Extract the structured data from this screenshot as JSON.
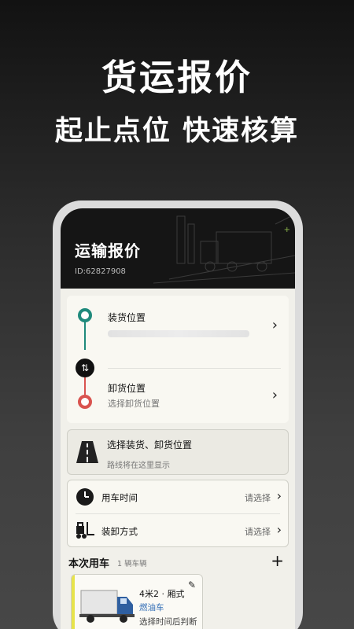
{
  "promo": {
    "headline": "货运报价",
    "subheadline": "起止点位 快速核算"
  },
  "header": {
    "title": "运输报价",
    "id": "ID:62827908"
  },
  "locations": {
    "load": {
      "label": "装货位置",
      "value": ""
    },
    "unload": {
      "label": "卸货位置",
      "placeholder": "选择卸货位置"
    },
    "colors": {
      "load": "#1f8a7c",
      "unload": "#d9534f"
    }
  },
  "route": {
    "title": "选择装货、卸货位置",
    "subtitle": "路线将在这里显示"
  },
  "options": {
    "time": {
      "label": "用车时间",
      "value": "请选择"
    },
    "method": {
      "label": "装卸方式",
      "value": "请选择"
    }
  },
  "vehicles": {
    "title": "本次用车",
    "count": "1 辆车辆",
    "card": {
      "size": "4米2 · 厢式",
      "fuel": "燃油车",
      "note": "选择时间后判断"
    }
  }
}
